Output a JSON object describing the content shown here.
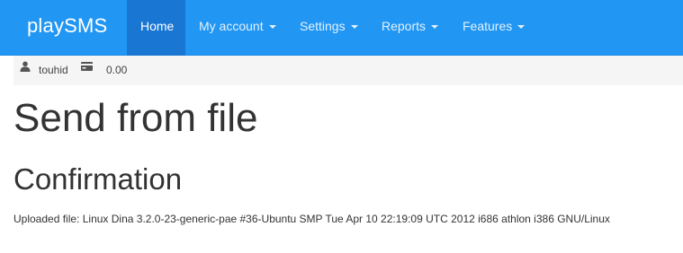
{
  "navbar": {
    "brand": "playSMS",
    "items": [
      {
        "label": "Home",
        "active": true,
        "dropdown": false
      },
      {
        "label": "My account",
        "active": false,
        "dropdown": true
      },
      {
        "label": "Settings",
        "active": false,
        "dropdown": true
      },
      {
        "label": "Reports",
        "active": false,
        "dropdown": true
      },
      {
        "label": "Features",
        "active": false,
        "dropdown": true
      }
    ],
    "colors": {
      "background": "#2196f3",
      "active": "#1976d2"
    }
  },
  "userbar": {
    "user_icon": "user-icon",
    "username": "touhid",
    "credit_icon": "credit-card-icon",
    "credit": "0.00"
  },
  "main": {
    "title": "Send from file",
    "section_title": "Confirmation",
    "uploaded_label": "Uploaded file:",
    "uploaded_value": "Linux Dina 3.2.0-23-generic-pae #36-Ubuntu SMP Tue Apr 10 22:19:09 UTC 2012 i686 athlon i386 GNU/Linux"
  }
}
